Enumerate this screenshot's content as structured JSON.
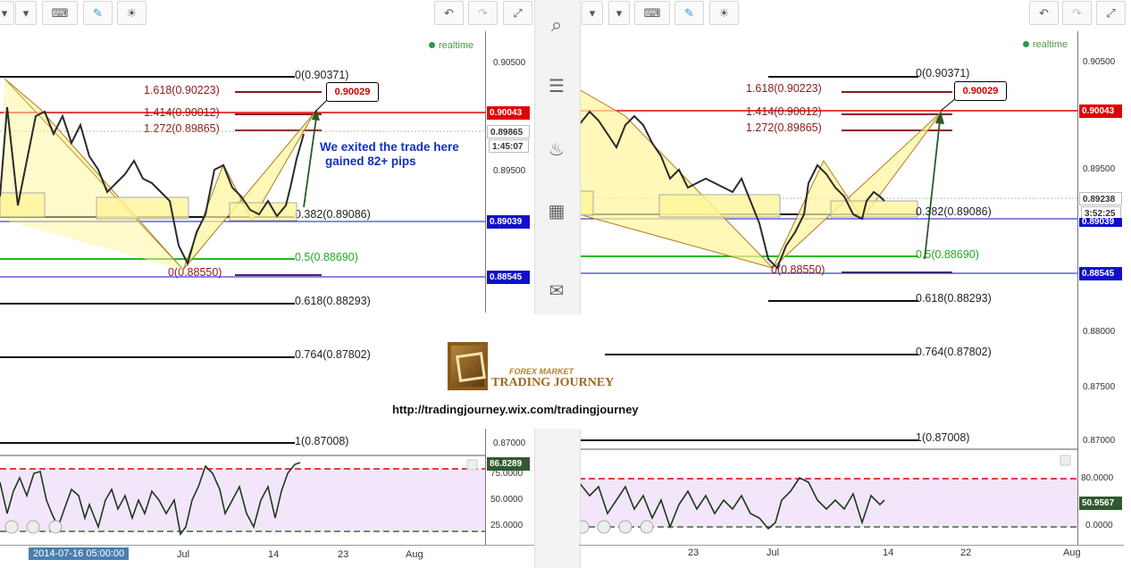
{
  "left_panel": {
    "realtime": "realtime",
    "price_axis": [
      "0.90500",
      "0.89500",
      "0.87000",
      "75.0000",
      "50.0000",
      "25.0000"
    ],
    "price_tags": {
      "red": "0.90043",
      "grey": "0.89865",
      "time": "1:45:07",
      "blue1": "0.89039",
      "blue2": "0.88545",
      "osc": "86.8289"
    },
    "fib_levels": [
      "0(0.90371)",
      "1.618(0.90223)",
      "1.414(0.90012)",
      "1.272(0.89865)",
      "0.382(0.89086)",
      "0.5(0.88690)",
      "0(0.88550)",
      "0.618(0.88293)",
      "0.764(0.87802)",
      "1(0.87008)"
    ],
    "callout": "0.90029",
    "annotation_line1": "We exited the trade here",
    "annotation_line2": "gained 82+ pips",
    "time_axis": [
      "Jul",
      "14",
      "23",
      "Aug"
    ],
    "crosshair_time": "2014-07-16 05:00:00"
  },
  "right_panel": {
    "realtime": "realtime",
    "price_axis": [
      "0.90500",
      "0.89500",
      "0.88000",
      "0.87500",
      "0.87000",
      "80.0000",
      "0.0000"
    ],
    "price_tags": {
      "red": "0.90043",
      "grey": "0.89238",
      "time": "3:52:25",
      "blue1": "0.89039",
      "blue2": "0.88545",
      "osc": "50.9567"
    },
    "fib_levels": [
      "0(0.90371)",
      "1.618(0.90223)",
      "1.414(0.90012)",
      "1.272(0.89865)",
      "0.382(0.89086)",
      "0.5(0.88690)",
      "0(0.88550)",
      "0.618(0.88293)",
      "0.764(0.87802)",
      "1(0.87008)"
    ],
    "callout": "0.90029",
    "time_axis": [
      "23",
      "Jul",
      "14",
      "22",
      "Aug"
    ]
  },
  "watermark": {
    "brand_top": "FOREX MARKET",
    "brand_main": "TRADING JOURNEY",
    "url": "http://tradingjourney.wix.com/tradingjourney"
  },
  "colors": {
    "red": "#e00000",
    "blue": "#0000cc",
    "green": "#22bb22",
    "dark_red": "#8b1a1a",
    "yellow_fill": "#fff59a",
    "osc_fill": "#f3e6fb"
  }
}
